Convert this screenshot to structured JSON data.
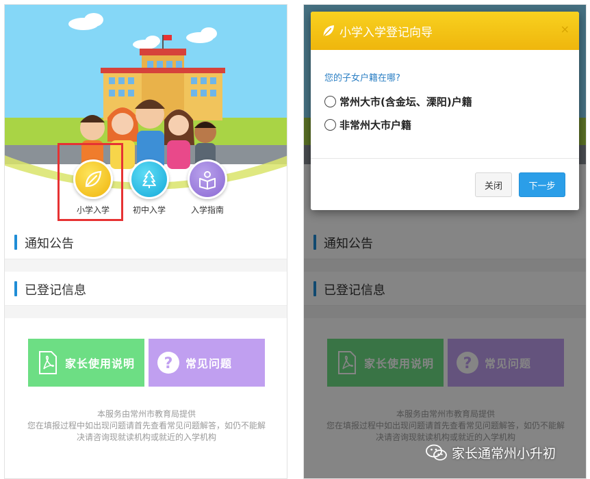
{
  "home": {
    "entries": [
      {
        "label": "小学入学",
        "icon": "leaf-icon"
      },
      {
        "label": "初中入学",
        "icon": "tree-icon"
      },
      {
        "label": "入学指南",
        "icon": "reading-icon"
      }
    ],
    "sections": {
      "notice": "通知公告",
      "registered": "已登记信息"
    },
    "cards": {
      "manual": "家长使用说明",
      "faq": "常见问题"
    },
    "footer": {
      "line1": "本服务由常州市教育局提供",
      "line2": "您在填报过程中如出现问题请首先查看常见问题解答，如仍不能解",
      "line3": "决请咨询现就读机构或就近的入学机构"
    },
    "colors": {
      "accent": "#1f8dd6",
      "highlight": "#e63233",
      "manual_card": "#6dde84",
      "faq_card": "#c09ff0"
    }
  },
  "modal": {
    "title": "小学入学登记向导",
    "close_symbol": "×",
    "question": "您的子女户籍在哪?",
    "options": [
      "常州大市(含金坛、溧阳)户籍",
      "非常州大市户籍"
    ],
    "buttons": {
      "close": "关闭",
      "next": "下一步"
    },
    "colors": {
      "header": "#f3c214",
      "primary": "#2b9ee8"
    }
  },
  "watermark": {
    "text": "家长通常州小升初",
    "icon": "wechat-icon"
  }
}
